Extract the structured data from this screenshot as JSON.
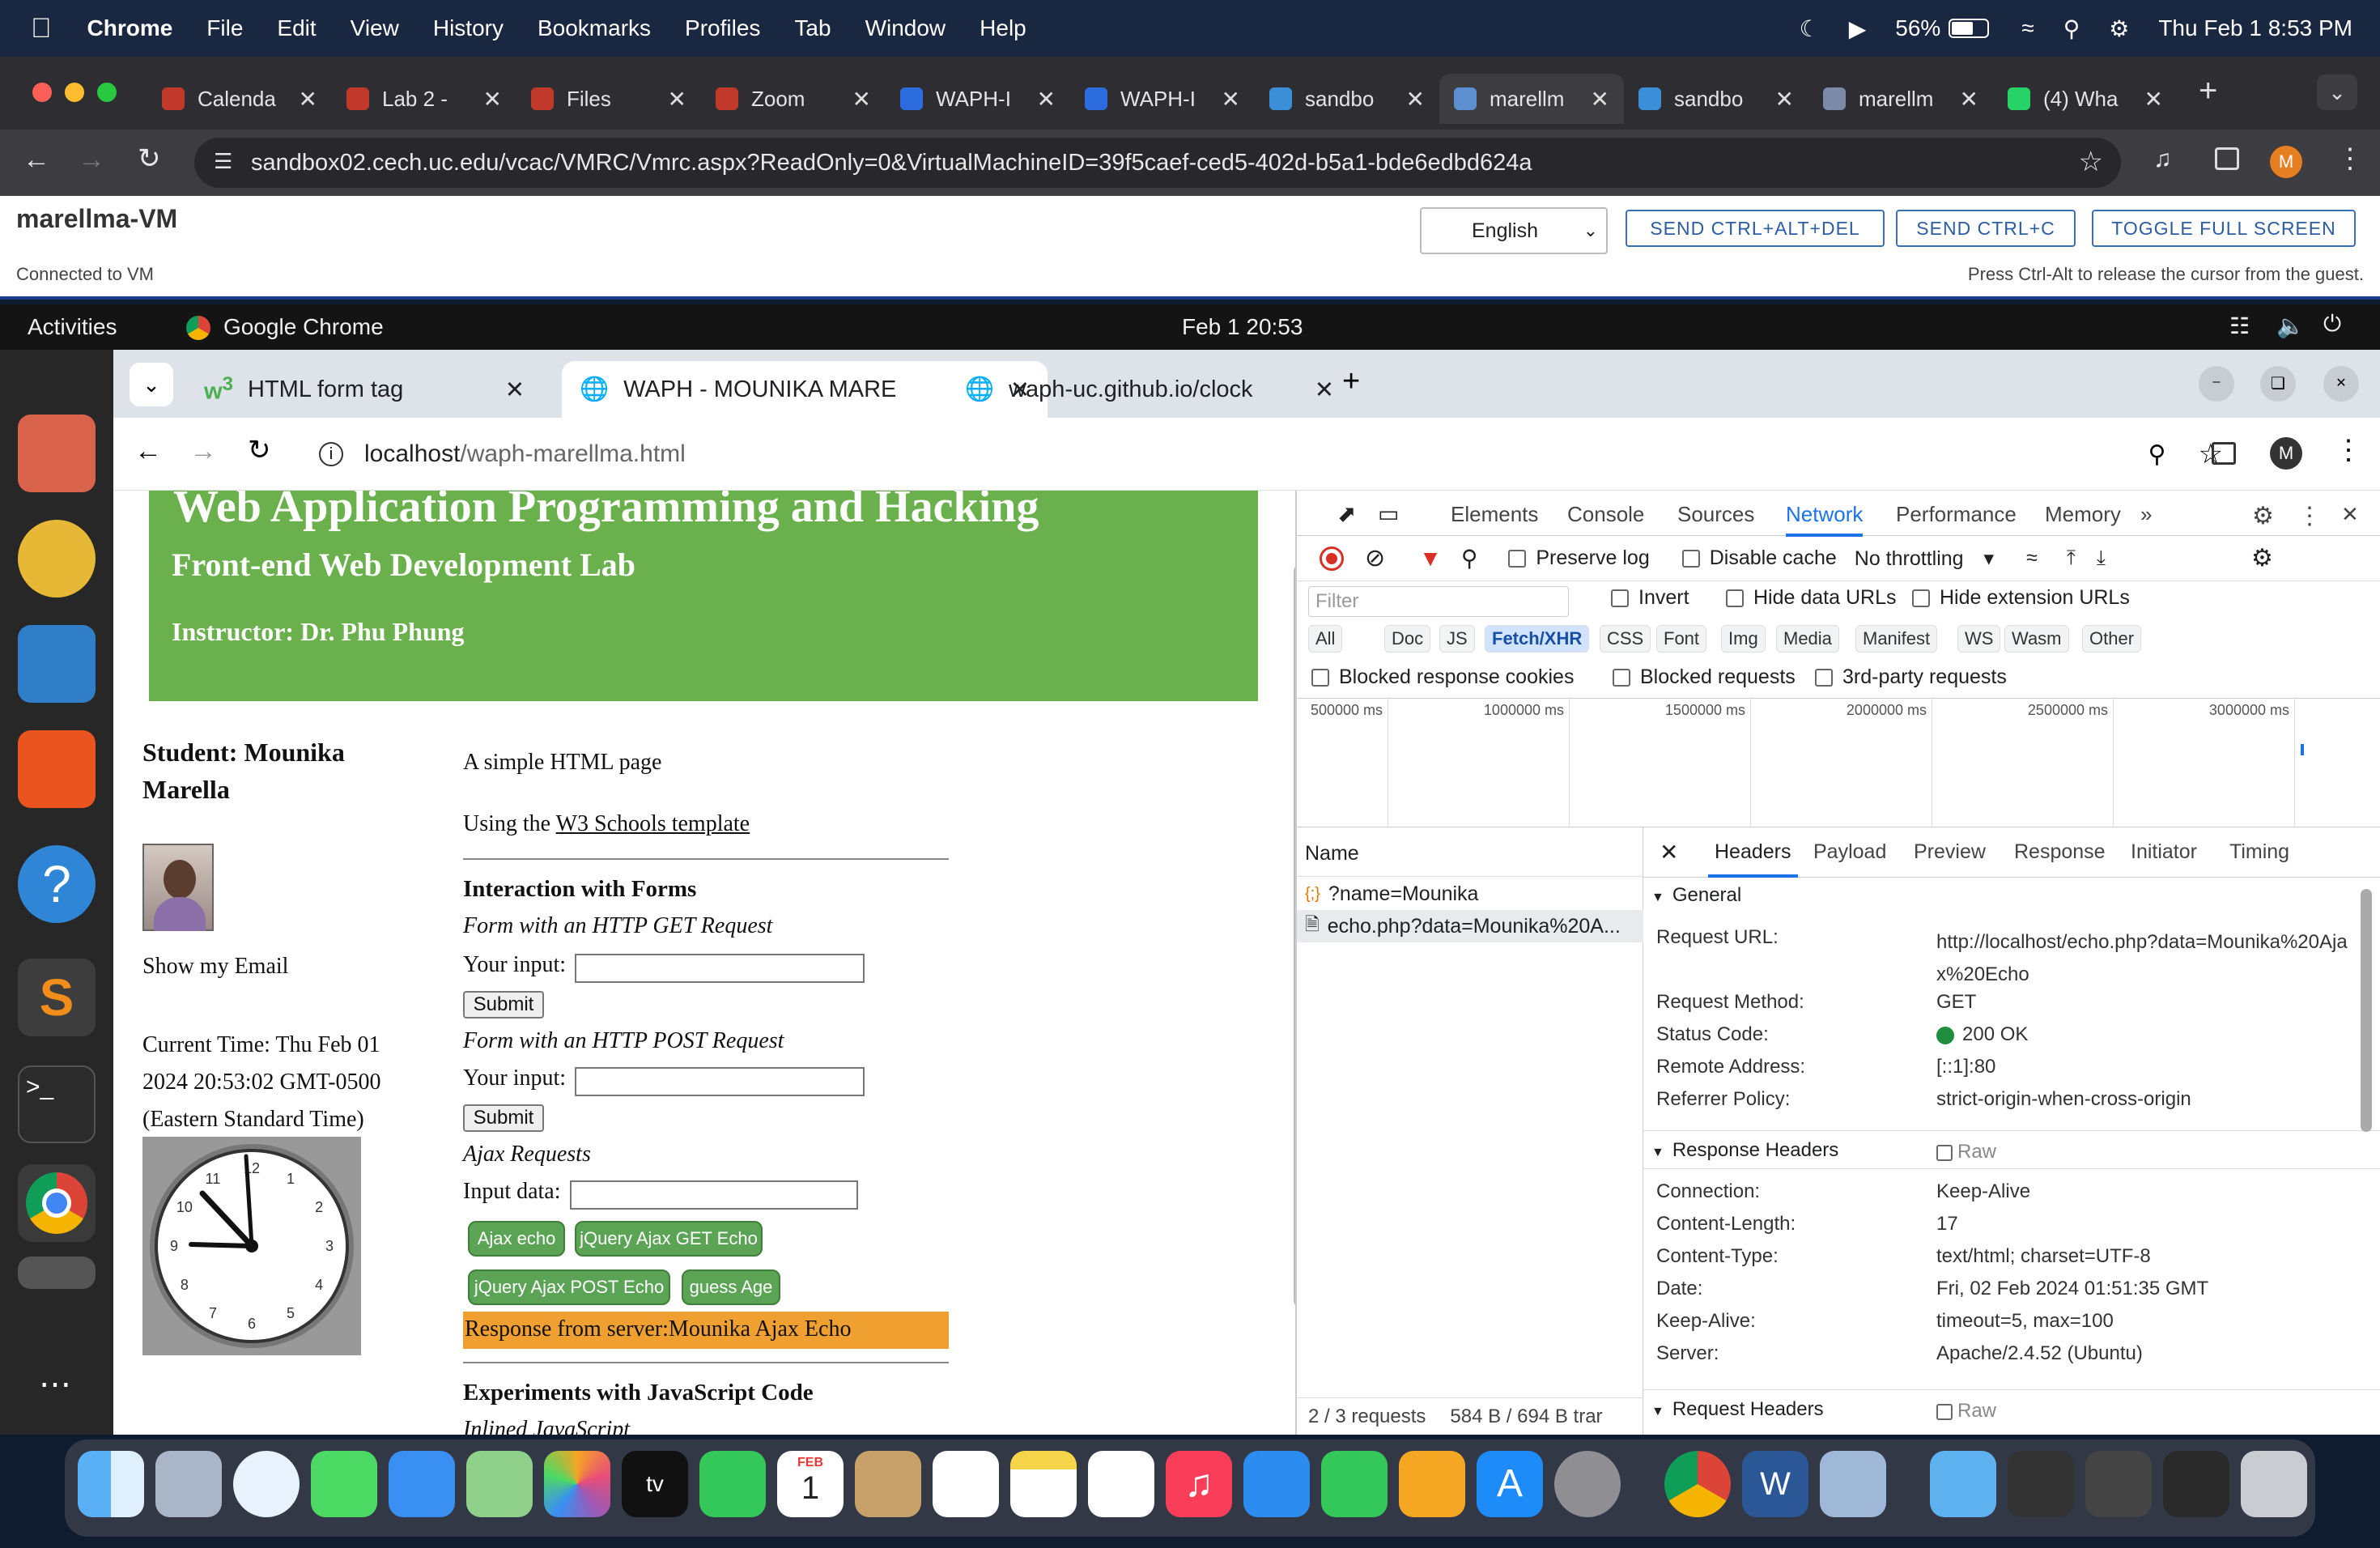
{
  "macbar": {
    "app": "Chrome",
    "menus": [
      "File",
      "Edit",
      "View",
      "History",
      "Bookmarks",
      "Profiles",
      "Tab",
      "Window",
      "Help"
    ],
    "battery": "56%",
    "datetime": "Thu Feb 1  8:53 PM"
  },
  "mac_tabs": [
    {
      "label": "Calenda",
      "color": "#c0392b"
    },
    {
      "label": "Lab 2 -",
      "color": "#c0392b"
    },
    {
      "label": "Files",
      "color": "#c0392b"
    },
    {
      "label": "Zoom",
      "color": "#c0392b"
    },
    {
      "label": "WAPH-I",
      "color": "#2d6cdf"
    },
    {
      "label": "WAPH-I",
      "color": "#2d6cdf"
    },
    {
      "label": "sandbo",
      "color": "#3a8fd8"
    },
    {
      "label": "marellm",
      "color": "#5b8fd0"
    },
    {
      "label": "sandbo",
      "color": "#3a8fd8"
    },
    {
      "label": "marellm",
      "color": "#7a8aa8"
    },
    {
      "label": "(4) Wha",
      "color": "#25d366"
    }
  ],
  "mac_url": "sandbox02.cech.uc.edu/vcac/VMRC/Vmrc.aspx?ReadOnly=0&VirtualMachineID=39f5caef-ced5-402d-b5a1-bde6edbd624a",
  "vmrc": {
    "title": "marellma-VM",
    "status": "Connected to VM",
    "language": "English",
    "btn_cad": "SEND CTRL+ALT+DEL",
    "btn_cc": "SEND CTRL+C",
    "btn_fs": "TOGGLE FULL SCREEN",
    "hint": "Press Ctrl-Alt to release the cursor from the guest."
  },
  "ubuntu": {
    "activities": "Activities",
    "app": "Google Chrome",
    "clock": "Feb 1  20:53"
  },
  "vm_tabs": [
    {
      "label": "HTML form tag"
    },
    {
      "label": "WAPH - MOUNIKA MARE"
    },
    {
      "label": "waph-uc.github.io/clock"
    }
  ],
  "vm_url": {
    "host": "localhost",
    "path": "/waph-marellma.html"
  },
  "page": {
    "h1": "Web Application Programming and Hacking",
    "h2": "Front-end Web Development Lab",
    "instructor": "Instructor: Dr. Phu Phung",
    "student": "Student: Mounika Marella",
    "show_email": "Show my Email",
    "time_label": "Current Time: Thu Feb 01 2024 20:53:02 GMT-0500 (Eastern Standard Time)",
    "simple": "A simple HTML page",
    "using": "Using the ",
    "w3": "W3 Schools template",
    "forms_h": "Interaction with Forms",
    "get_h": "Form with an HTTP GET Request",
    "your_input": "Your input:",
    "submit": "Submit",
    "post_h": "Form with an HTTP POST Request",
    "ajax_h": "Ajax Requests",
    "input_data": "Input data:",
    "btn_ajax": "Ajax echo",
    "btn_jget": "jQuery Ajax GET Echo",
    "btn_jpost": "jQuery Ajax POST Echo",
    "btn_age": "guess Age",
    "response": "Response from server:Mounika Ajax Echo",
    "exp_h": "Experiments with JavaScript Code",
    "inlined": "Inlined JavaScript"
  },
  "devtools": {
    "tabs": [
      "Elements",
      "Console",
      "Sources",
      "Network",
      "Performance",
      "Memory"
    ],
    "active_tab": "Network",
    "preserve": "Preserve log",
    "disable_cache": "Disable cache",
    "throttle": "No throttling",
    "filter_ph": "Filter",
    "invert": "Invert",
    "hide_data": "Hide data URLs",
    "hide_ext": "Hide extension URLs",
    "chips": [
      "All",
      "Doc",
      "JS",
      "Fetch/XHR",
      "CSS",
      "Font",
      "Img",
      "Media",
      "Manifest",
      "WS",
      "Wasm",
      "Other"
    ],
    "blocked_cookies": "Blocked response cookies",
    "blocked_req": "Blocked requests",
    "third_party": "3rd-party requests",
    "timeline": [
      "500000 ms",
      "1000000 ms",
      "1500000 ms",
      "2000000 ms",
      "2500000 ms",
      "3000000 ms"
    ],
    "name_col": "Name",
    "requests": [
      "?name=Mounika",
      "echo.php?data=Mounika%20A..."
    ],
    "panel_tabs": [
      "Headers",
      "Payload",
      "Preview",
      "Response",
      "Initiator",
      "Timing"
    ],
    "general": "General",
    "req_url_k": "Request URL:",
    "req_url_v": "http://localhost/echo.php?data=Mounika%20Ajax%20Echo",
    "method_k": "Request Method:",
    "method_v": "GET",
    "status_k": "Status Code:",
    "status_v": "200 OK",
    "remote_k": "Remote Address:",
    "remote_v": "[::1]:80",
    "ref_k": "Referrer Policy:",
    "ref_v": "strict-origin-when-cross-origin",
    "resp_h": "Response Headers",
    "raw": "Raw",
    "conn_k": "Connection:",
    "conn_v": "Keep-Alive",
    "len_k": "Content-Length:",
    "len_v": "17",
    "type_k": "Content-Type:",
    "type_v": "text/html; charset=UTF-8",
    "date_k": "Date:",
    "date_v": "Fri, 02 Feb 2024 01:51:35 GMT",
    "ka_k": "Keep-Alive:",
    "ka_v": "timeout=5, max=100",
    "srv_k": "Server:",
    "srv_v": "Apache/2.4.52 (Ubuntu)",
    "req_h": "Request Headers",
    "summary": "2 / 3 requests",
    "transfer": "584 B / 694 B trar"
  },
  "dock_cal": {
    "month": "FEB",
    "day": "1"
  }
}
